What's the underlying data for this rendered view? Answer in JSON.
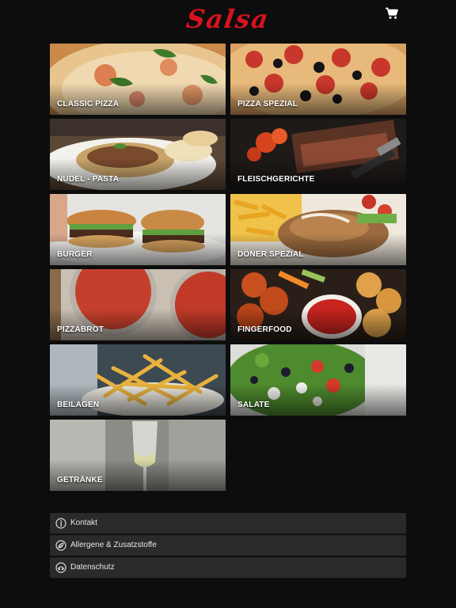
{
  "brand": {
    "logo_text": "Salsa"
  },
  "header": {
    "cart_icon": "cart-icon"
  },
  "categories": [
    {
      "label": "CLASSIC PIZZA"
    },
    {
      "label": "PIZZA SPEZIAL"
    },
    {
      "label": "NUDEL - PASTA"
    },
    {
      "label": "FLEISCHGERICHTE"
    },
    {
      "label": "BURGER"
    },
    {
      "label": "DÖNER SPEZIAL"
    },
    {
      "label": "PIZZABROT"
    },
    {
      "label": "FINGERFOOD"
    },
    {
      "label": "BEILAGEN"
    },
    {
      "label": "SALATE"
    },
    {
      "label": "GETRÄNKE"
    }
  ],
  "footer_links": [
    {
      "label": "Kontakt",
      "icon": "info-icon"
    },
    {
      "label": "Allergene & Zusatzstoffe",
      "icon": "allergen-icon"
    },
    {
      "label": "Datenschutz",
      "icon": "privacy-icon"
    }
  ],
  "colors": {
    "brand_red": "#d9121f",
    "link_bg": "#2a2a2a",
    "page_bg": "#0c0c0c"
  }
}
